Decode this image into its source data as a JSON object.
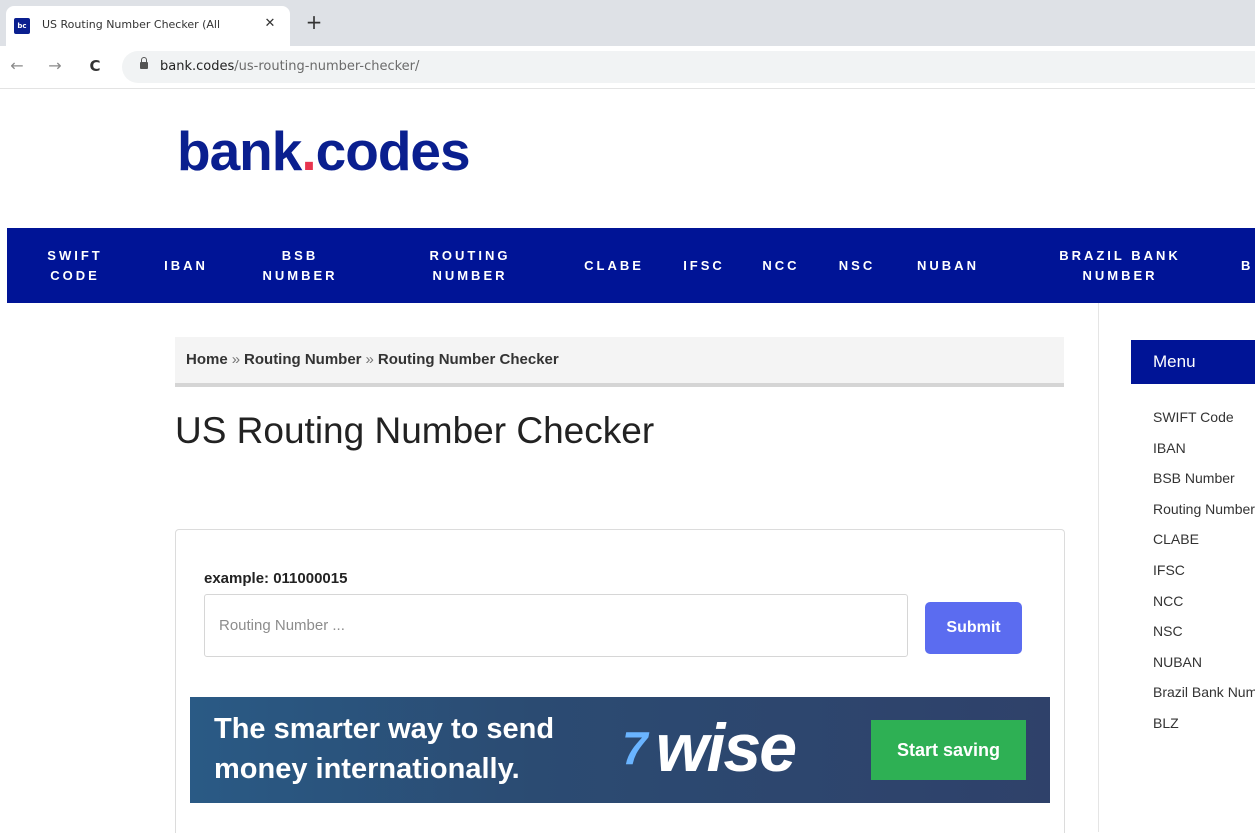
{
  "browser": {
    "tab_title": "US Routing Number Checker (All",
    "tab_favicon_text": "bc",
    "tab_close": "✕",
    "new_tab": "+",
    "back": "←",
    "forward": "→",
    "reload": "C",
    "url_domain": "bank.codes",
    "url_path": "/us-routing-number-checker/"
  },
  "logo": {
    "main": "bank",
    "dot": ".",
    "suffix": "codes"
  },
  "nav": [
    "SWIFT\nCODE",
    "IBAN",
    "BSB\nNUMBER",
    "ROUTING\nNUMBER",
    "CLABE",
    "IFSC",
    "NCC",
    "NSC",
    "NUBAN",
    "BRAZIL BANK\nNUMBER",
    "B"
  ],
  "breadcrumb": {
    "home": "Home",
    "sep": "»",
    "routing": "Routing Number",
    "current": "Routing Number Checker"
  },
  "page_title": "US Routing Number Checker",
  "form": {
    "example": "example: 011000015",
    "placeholder": "Routing Number ...",
    "value": "",
    "submit": "Submit"
  },
  "ad": {
    "text": "The smarter way to send\nmoney internationally.",
    "brand_flag": "7",
    "brand": "wise",
    "cta": "Start saving"
  },
  "sidebar": {
    "header": "Menu",
    "items": [
      "SWIFT Code",
      "IBAN",
      "BSB Number",
      "Routing Number",
      "CLABE",
      "IFSC",
      "NCC",
      "NSC",
      "NUBAN",
      "Brazil Bank Number",
      "BLZ"
    ]
  },
  "colors": {
    "brand_blue": "#001496",
    "logo_dot": "#e8344e",
    "submit": "#5b6cf0",
    "cta_green": "#2eb054"
  }
}
